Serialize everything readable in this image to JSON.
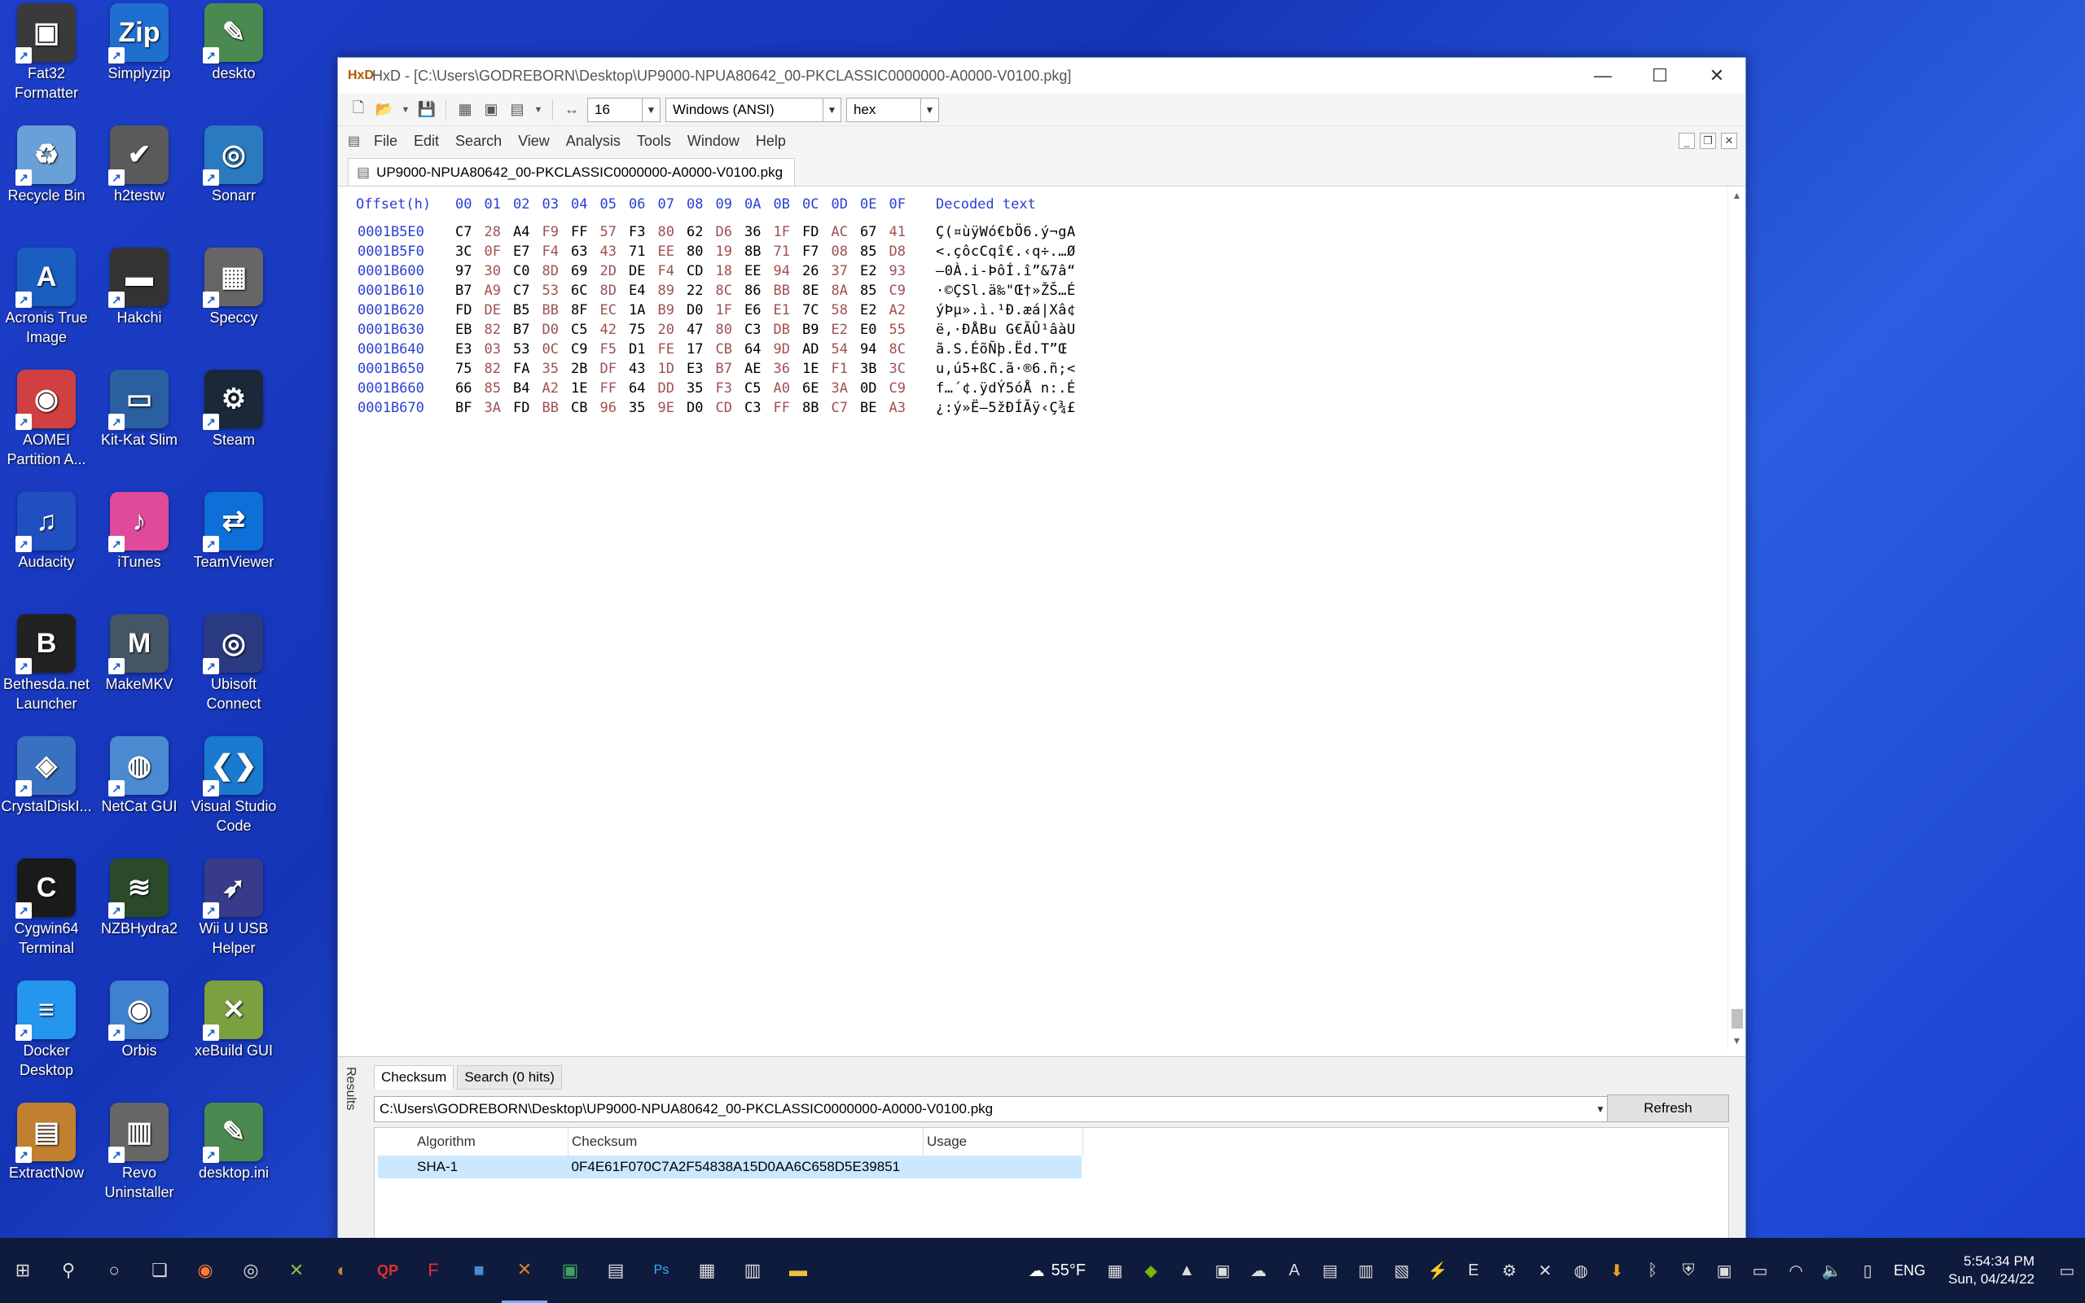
{
  "desktop": {
    "icons": [
      {
        "label": "Fat32\nFormatter",
        "glyph": "▣",
        "color": "#3a3a3a"
      },
      {
        "label": "Simplyzip",
        "glyph": "Zip",
        "color": "#1f6fd0"
      },
      {
        "label": "deskto",
        "glyph": "✎",
        "color": "#4a8a50"
      },
      {
        "label": "Recycle Bin",
        "glyph": "♻",
        "color": "#6aa0d8"
      },
      {
        "label": "h2testw",
        "glyph": "✔",
        "color": "#5a5a5a"
      },
      {
        "label": "Sonarr",
        "glyph": "◎",
        "color": "#2a7ac0"
      },
      {
        "label": "Acronis True\nImage",
        "glyph": "A",
        "color": "#1a5fc0"
      },
      {
        "label": "Hakchi",
        "glyph": "▬",
        "color": "#333333"
      },
      {
        "label": "Speccy",
        "glyph": "▦",
        "color": "#666666"
      },
      {
        "label": "AOMEI\nPartition A...",
        "glyph": "◉",
        "color": "#d04040"
      },
      {
        "label": "Kit-Kat Slim",
        "glyph": "▭",
        "color": "#2a5fa0"
      },
      {
        "label": "Steam",
        "glyph": "⚙",
        "color": "#1b2838"
      },
      {
        "label": "Audacity",
        "glyph": "♫",
        "color": "#2050c0"
      },
      {
        "label": "iTunes",
        "glyph": "♪",
        "color": "#e04a9a"
      },
      {
        "label": "TeamViewer",
        "glyph": "⇄",
        "color": "#0e6fd8"
      },
      {
        "label": "Bethesda.net\nLauncher",
        "glyph": "B",
        "color": "#222222"
      },
      {
        "label": "MakeMKV",
        "glyph": "M",
        "color": "#445566"
      },
      {
        "label": "Ubisoft\nConnect",
        "glyph": "◎",
        "color": "#2a3a80"
      },
      {
        "label": "CrystalDiskI...",
        "glyph": "◈",
        "color": "#3a70c0"
      },
      {
        "label": "NetCat GUI",
        "glyph": "◍",
        "color": "#4a8ad0"
      },
      {
        "label": "Visual Studio\nCode",
        "glyph": "❮❯",
        "color": "#1a7ad0"
      },
      {
        "label": "Cygwin64\nTerminal",
        "glyph": "C",
        "color": "#1a1a1a"
      },
      {
        "label": "NZBHydra2",
        "glyph": "≋",
        "color": "#2a4a2a"
      },
      {
        "label": "Wii U USB\nHelper",
        "glyph": "➶",
        "color": "#3a3a8a"
      },
      {
        "label": "Docker\nDesktop",
        "glyph": "≡",
        "color": "#2496ed"
      },
      {
        "label": "Orbis",
        "glyph": "◉",
        "color": "#4080d0"
      },
      {
        "label": "xeBuild GUI",
        "glyph": "✕",
        "color": "#7aa040"
      },
      {
        "label": "ExtractNow",
        "glyph": "▤",
        "color": "#c08030"
      },
      {
        "label": "Revo\nUninstaller",
        "glyph": "▥",
        "color": "#666666"
      },
      {
        "label": "desktop.ini",
        "glyph": "✎",
        "color": "#4a8a50"
      }
    ]
  },
  "window": {
    "title": "HxD - [C:\\Users\\GODREBORN\\Desktop\\UP9000-NPUA80642_00-PKCLASSIC0000000-A0000-V0100.pkg]",
    "app_icon": "HxD",
    "minimize": "—",
    "maximize": "☐",
    "close": "✕"
  },
  "toolbar": {
    "bytes_per_row": "16",
    "charset": "Windows (ANSI)",
    "mode": "hex"
  },
  "menu": {
    "items": [
      "File",
      "Edit",
      "Search",
      "View",
      "Analysis",
      "Tools",
      "Window",
      "Help"
    ]
  },
  "tab": {
    "label": "UP9000-NPUA80642_00-PKCLASSIC0000000-A0000-V0100.pkg"
  },
  "hex": {
    "header_offset": "Offset(h)",
    "header_columns": [
      "00",
      "01",
      "02",
      "03",
      "04",
      "05",
      "06",
      "07",
      "08",
      "09",
      "0A",
      "0B",
      "0C",
      "0D",
      "0E",
      "0F"
    ],
    "header_decoded": "Decoded text",
    "rows": [
      {
        "offset": "0001B5E0",
        "bytes": [
          "C7",
          "28",
          "A4",
          "F9",
          "FF",
          "57",
          "F3",
          "80",
          "62",
          "D6",
          "36",
          "1F",
          "FD",
          "AC",
          "67",
          "41"
        ],
        "decoded": "Ç(¤ùÿWó€bÖ6.ý¬gA"
      },
      {
        "offset": "0001B5F0",
        "bytes": [
          "3C",
          "0F",
          "E7",
          "F4",
          "63",
          "43",
          "71",
          "EE",
          "80",
          "19",
          "8B",
          "71",
          "F7",
          "08",
          "85",
          "D8"
        ],
        "decoded": "<.çôcCqî€.‹q÷.…Ø"
      },
      {
        "offset": "0001B600",
        "bytes": [
          "97",
          "30",
          "C0",
          "8D",
          "69",
          "2D",
          "DE",
          "F4",
          "CD",
          "18",
          "EE",
          "94",
          "26",
          "37",
          "E2",
          "93"
        ],
        "decoded": "—0À.i-ÞôÍ.î”&7â“"
      },
      {
        "offset": "0001B610",
        "bytes": [
          "B7",
          "A9",
          "C7",
          "53",
          "6C",
          "8D",
          "E4",
          "89",
          "22",
          "8C",
          "86",
          "BB",
          "8E",
          "8A",
          "85",
          "C9"
        ],
        "decoded": "·©ÇSl.ä‰\"Œ†»ŽŠ…É"
      },
      {
        "offset": "0001B620",
        "bytes": [
          "FD",
          "DE",
          "B5",
          "BB",
          "8F",
          "EC",
          "1A",
          "B9",
          "D0",
          "1F",
          "E6",
          "E1",
          "7C",
          "58",
          "E2",
          "A2"
        ],
        "decoded": "ýÞµ».ì.¹Ð.æá|Xâ¢"
      },
      {
        "offset": "0001B630",
        "bytes": [
          "EB",
          "82",
          "B7",
          "D0",
          "C5",
          "42",
          "75",
          "20",
          "47",
          "80",
          "C3",
          "DB",
          "B9",
          "E2",
          "E0",
          "55"
        ],
        "decoded": "ë‚·ÐÅBu G€ÃÛ¹âàU"
      },
      {
        "offset": "0001B640",
        "bytes": [
          "E3",
          "03",
          "53",
          "0C",
          "C9",
          "F5",
          "D1",
          "FE",
          "17",
          "CB",
          "64",
          "9D",
          "AD",
          "54",
          "94",
          "8C"
        ],
        "decoded": "ã.S.ÉõÑþ.Ëd.­T”Œ"
      },
      {
        "offset": "0001B650",
        "bytes": [
          "75",
          "82",
          "FA",
          "35",
          "2B",
          "DF",
          "43",
          "1D",
          "E3",
          "B7",
          "AE",
          "36",
          "1E",
          "F1",
          "3B",
          "3C"
        ],
        "decoded": "u‚ú5+ßC.ã·®6.ñ;<"
      },
      {
        "offset": "0001B660",
        "bytes": [
          "66",
          "85",
          "B4",
          "A2",
          "1E",
          "FF",
          "64",
          "DD",
          "35",
          "F3",
          "C5",
          "A0",
          "6E",
          "3A",
          "0D",
          "C9"
        ],
        "decoded": "f…´¢.ÿdÝ5óÅ n:.É"
      },
      {
        "offset": "0001B670",
        "bytes": [
          "BF",
          "3A",
          "FD",
          "BB",
          "CB",
          "96",
          "35",
          "9E",
          "D0",
          "CD",
          "C3",
          "FF",
          "8B",
          "C7",
          "BE",
          "A3"
        ],
        "decoded": "¿:ý»Ë–5žÐÍÃÿ‹Ç¾£"
      }
    ]
  },
  "results": {
    "panel_label": "Results",
    "tabs": [
      "Checksum",
      "Search (0 hits)"
    ],
    "file_path": "C:\\Users\\GODREBORN\\Desktop\\UP9000-NPUA80642_00-PKCLASSIC0000000-A0000-V0100.pkg",
    "refresh_label": "Refresh",
    "columns": [
      "Algorithm",
      "Checksum",
      "Usage"
    ],
    "rows": [
      {
        "algorithm": "SHA-1",
        "checksum": "0F4E61F070C7A2F54838A15D0AA6C658D5E39851",
        "usage": ""
      }
    ]
  },
  "taskbar": {
    "weather": "55°F",
    "language": "ENG",
    "time": "5:54:34 PM",
    "date": "Sun, 04/24/22"
  }
}
